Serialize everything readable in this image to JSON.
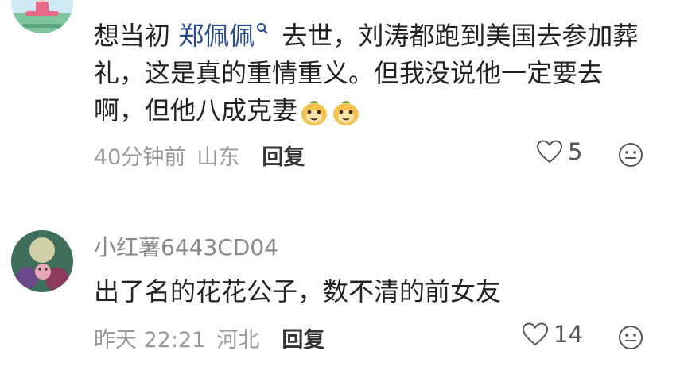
{
  "comments": [
    {
      "username": "",
      "content": {
        "before_mention": "想当初 ",
        "mention": "郑佩佩",
        "after_mention": " 去世，刘涛都跑到美国去参加葬礼，这是真的重情重义。但我没说他一定要去啊，但他八成克妻"
      },
      "emojis": [
        "smirk-sticker-icon",
        "smirk-sticker-icon"
      ],
      "meta": {
        "time": "40分钟前",
        "location": "山东",
        "reply_label": "回复"
      },
      "likes": "5",
      "icons": {
        "like": "heart-outline-icon",
        "react": "face-outline-icon"
      }
    },
    {
      "username": "小红薯6443CD04",
      "content": {
        "text": "出了名的花花公子，数不清的前女友"
      },
      "meta": {
        "time": "昨天 22:21",
        "location": "河北",
        "reply_label": "回复"
      },
      "likes": "14",
      "icons": {
        "like": "heart-outline-icon",
        "react": "face-outline-icon"
      }
    }
  ],
  "colors": {
    "mention": "#2a4d8f",
    "meta_text": "#9a9a9a",
    "body_text": "#222222"
  }
}
